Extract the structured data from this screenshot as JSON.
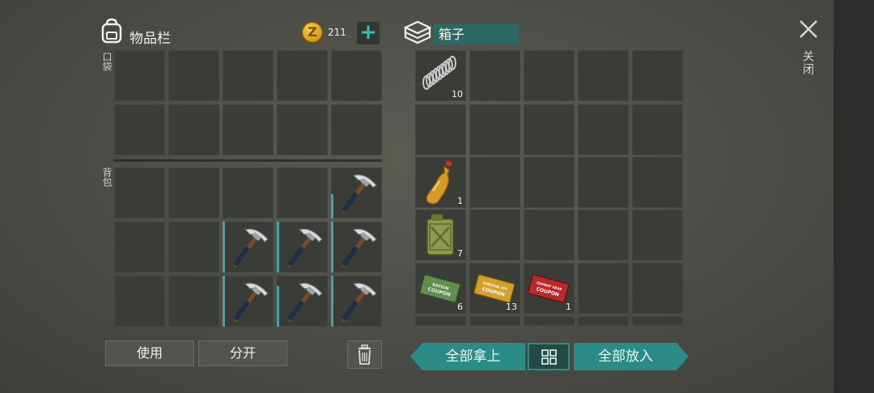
{
  "inventory": {
    "title": "物品栏",
    "coin_symbol": "Z",
    "coins": "211",
    "add_symbol": "+",
    "pocket_label": "口袋",
    "backpack_label": "背包"
  },
  "box": {
    "title": "箱子"
  },
  "actions": {
    "use_label": "使用",
    "split_label": "分开",
    "take_all_label": "全部拿上",
    "put_all_label": "全部放入"
  },
  "close": {
    "symbol": "✕",
    "label": "关闭"
  },
  "box_items": [
    {
      "name": "wire-coil-icon",
      "count": "10"
    },
    {
      "name": "water-bottle-icon",
      "count": "1"
    },
    {
      "name": "jerry-can-icon",
      "count": "7"
    },
    {
      "name": "ration-coupon-icon",
      "count": "6",
      "text": "RATION COUPON"
    },
    {
      "name": "survival-kit-coupon-icon",
      "count": "13",
      "text": "SURVIVAL KIT COUPON"
    },
    {
      "name": "combat-gear-coupon-icon",
      "count": "1",
      "text": "COMBAT GEAR COUPON"
    }
  ],
  "colors": {
    "accent": "#2a8b87",
    "teal_bar": "#3ea6a6",
    "coin": "#e0b030"
  }
}
